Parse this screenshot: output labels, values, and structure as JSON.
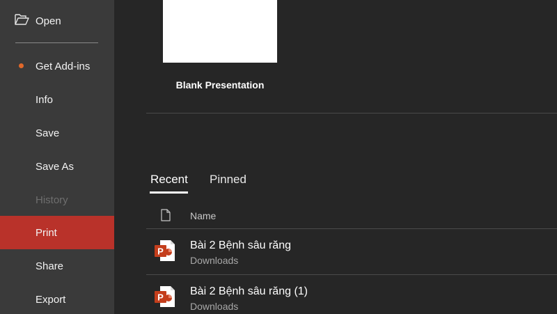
{
  "sidebar": {
    "items": [
      {
        "label": "Open",
        "icon": "folder-open-icon"
      },
      {
        "label": "Get Add-ins",
        "badge_color": "#e0682a"
      },
      {
        "label": "Info"
      },
      {
        "label": "Save"
      },
      {
        "label": "Save As"
      },
      {
        "label": "History",
        "state": "disabled"
      },
      {
        "label": "Print",
        "state": "selected"
      },
      {
        "label": "Share"
      },
      {
        "label": "Export"
      }
    ]
  },
  "new": {
    "blank_template_label": "Blank Presentation"
  },
  "tabs": {
    "recent": "Recent",
    "pinned": "Pinned",
    "selected": "Recent"
  },
  "file_list": {
    "name_header": "Name",
    "files": [
      {
        "title": "Bài 2 Bệnh sâu răng",
        "location": "Downloads",
        "icon": "powerpoint-file-icon"
      },
      {
        "title": "Bài 2 Bệnh sâu răng (1)",
        "location": "Downloads",
        "icon": "powerpoint-file-icon"
      }
    ]
  },
  "colors": {
    "sidebar_bg": "#3a3a3a",
    "main_bg": "#262626",
    "selected_accent": "#b9322a",
    "powerpoint_red": "#c43e1c"
  }
}
